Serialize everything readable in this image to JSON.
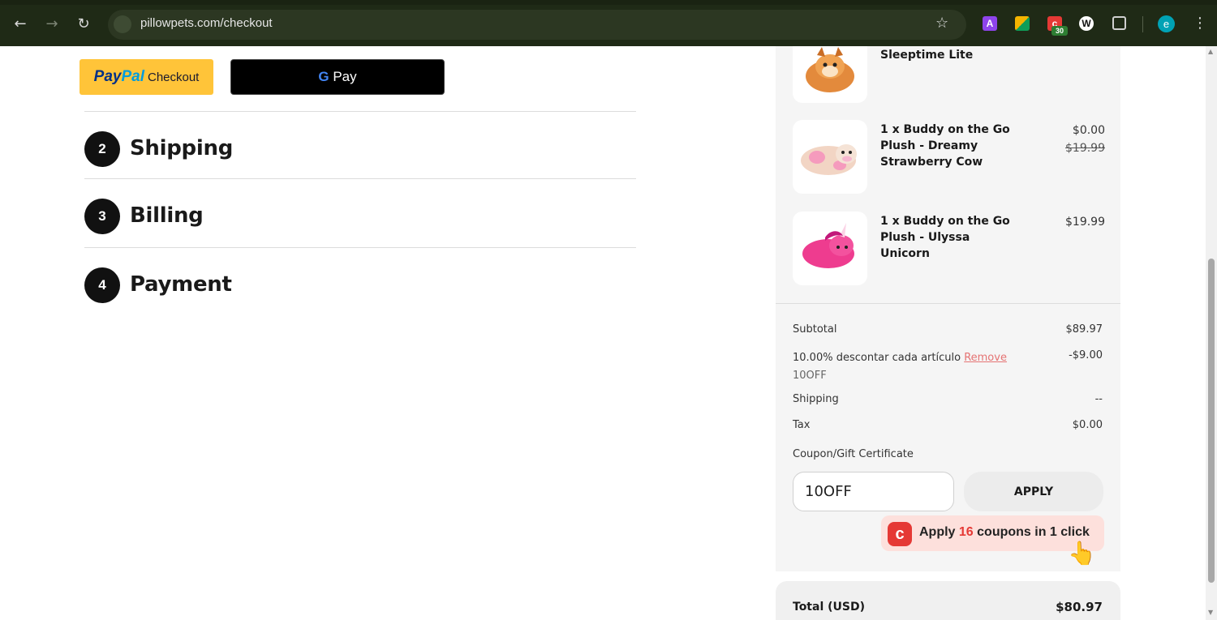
{
  "browser": {
    "url": "pillowpets.com/checkout",
    "extensions": [
      {
        "name": "A",
        "color": "#8e44ec"
      },
      {
        "name": "grid",
        "color": "#f4b400"
      },
      {
        "name": "honey",
        "color": "#e53935",
        "badge": "30"
      },
      {
        "name": "W",
        "color": "#ffffff"
      }
    ],
    "profile_initial": "e",
    "icons": {
      "back": "back-arrow-icon",
      "forward": "forward-arrow-icon",
      "reload": "reload-icon",
      "site_info": "site-info-icon",
      "bookmark": "star-icon",
      "extensions": "puzzle-icon",
      "menu": "kebab-menu-icon"
    }
  },
  "express_checkout": {
    "paypal_logo_pay": "Pay",
    "paypal_logo_pal": "Pal",
    "paypal_label": "Checkout",
    "gpay_g": "G",
    "gpay_label": "Pay"
  },
  "steps": [
    {
      "number": "2",
      "title": "Shipping"
    },
    {
      "number": "3",
      "title": "Billing"
    },
    {
      "number": "4",
      "title": "Payment"
    }
  ],
  "cart": {
    "items": [
      {
        "name": "Sleeptime Lite",
        "price": "",
        "original_price": ""
      },
      {
        "name": "1 x Buddy on the Go Plush - Dreamy Strawberry Cow",
        "price": "$0.00",
        "original_price": "$19.99"
      },
      {
        "name": "1 x Buddy on the Go Plush - Ulyssa Unicorn",
        "price": "$19.99",
        "original_price": ""
      }
    ]
  },
  "totals": {
    "subtotal_label": "Subtotal",
    "subtotal_value": "$89.97",
    "discount_label": "10.00% descontar cada artículo",
    "discount_remove": "Remove",
    "discount_code": "10OFF",
    "discount_value": "-$9.00",
    "shipping_label": "Shipping",
    "shipping_value": "--",
    "tax_label": "Tax",
    "tax_value": "$0.00",
    "coupon_label": "Coupon/Gift Certificate",
    "coupon_value": "10OFF",
    "apply_label": "APPLY",
    "total_label": "Total (USD)",
    "total_value": "$80.97"
  },
  "honey": {
    "prefix": "Apply",
    "count": "16",
    "suffix": "coupons in 1 click"
  }
}
